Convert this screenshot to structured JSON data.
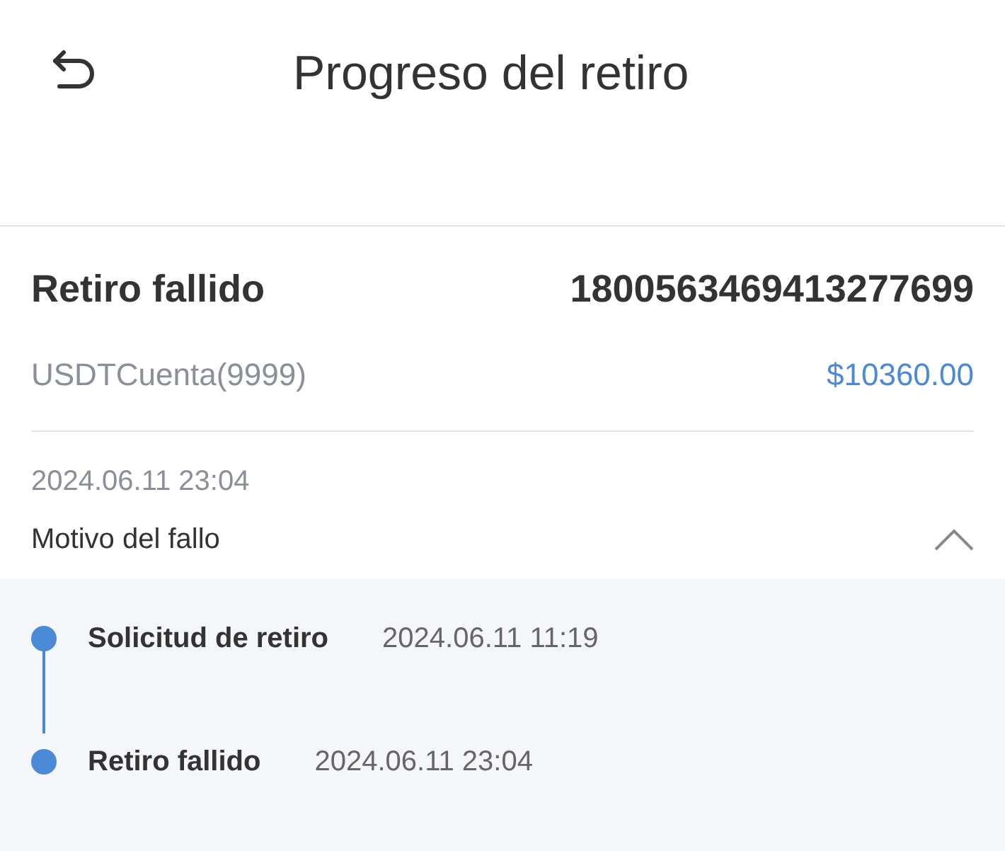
{
  "header": {
    "title": "Progreso del retiro"
  },
  "summary": {
    "status": "Retiro fallido",
    "order_number": "1800563469413277699",
    "account": "USDTCuenta(9999)",
    "amount": "$10360.00",
    "date": "2024.06.11 23:04"
  },
  "reason": {
    "label": "Motivo del fallo",
    "expanded": true
  },
  "timeline": [
    {
      "label": "Solicitud de retiro",
      "time": "2024.06.11 11:19"
    },
    {
      "label": "Retiro fallido",
      "time": "2024.06.11 23:04"
    }
  ]
}
